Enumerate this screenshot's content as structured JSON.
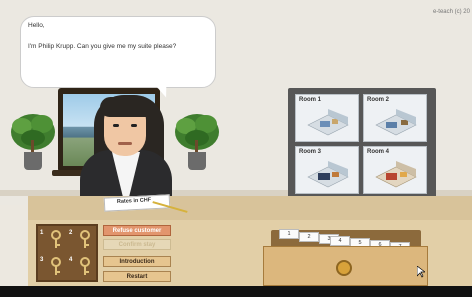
{
  "credit": "e-teach (c) 20",
  "dialog": {
    "lines": [
      "Hello,",
      "I'm Philip Krupp. Can you give me my suite please?"
    ]
  },
  "monitor": {
    "rooms": [
      {
        "label": "Room 1"
      },
      {
        "label": "Room 2"
      },
      {
        "label": "Room 3"
      },
      {
        "label": "Room 4"
      }
    ]
  },
  "desk": {
    "rate_sheet_title": "Rates in CHF"
  },
  "keys": [
    "1",
    "2",
    "3",
    "4"
  ],
  "buttons": {
    "refuse": "Refuse customer",
    "disabled": "Confirm stay",
    "introduction": "Introduction",
    "restart": "Restart"
  },
  "card_drawer": {
    "cards": [
      "1",
      "2",
      "3",
      "4",
      "5",
      "6",
      "7"
    ]
  },
  "colors": {
    "wall": "#ebe8e1",
    "desk": "#d8c39a",
    "refuse_button": "#e2956d",
    "keyboard": "#7a5630"
  }
}
